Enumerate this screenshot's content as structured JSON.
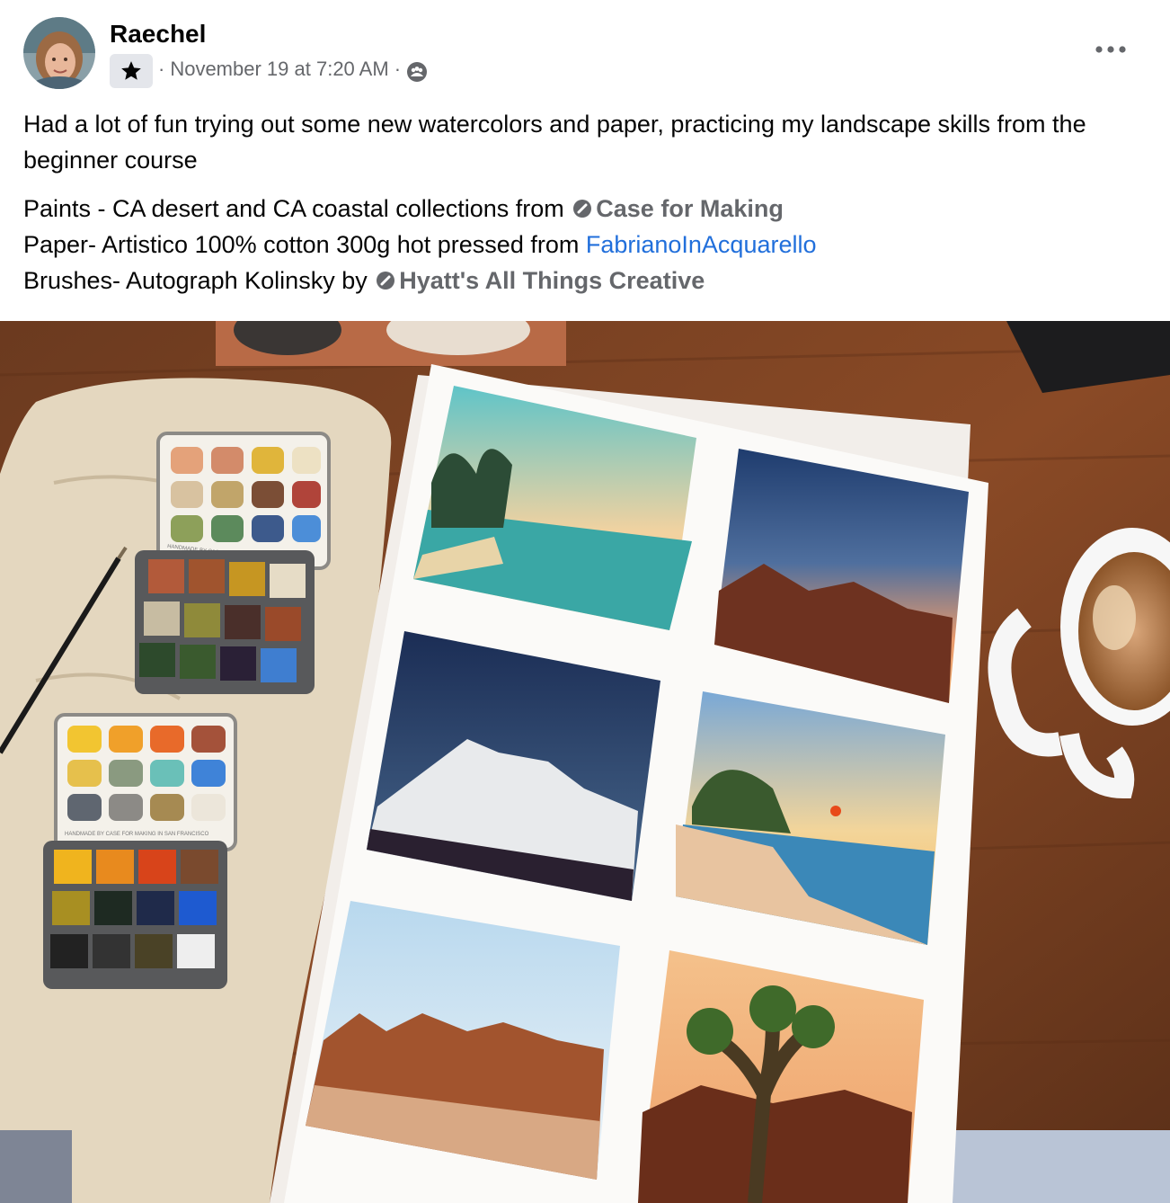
{
  "post": {
    "author": "Raechel",
    "badge_icon": "star-icon",
    "meta_separator": "·",
    "timestamp": "November 19 at 7:20 AM",
    "audience_icon": "group-audience-icon",
    "more_icon": "more-options-icon",
    "body_paragraph": "Had a lot of fun trying out some new watercolors and paper, practicing my landscape skills from the beginner course",
    "details": {
      "line1_prefix": "Paints - CA desert and CA coastal collections from ",
      "line1_link": "Case for Making",
      "line2_prefix": "Paper- Artistico 100% cotton 300g hot pressed from ",
      "line2_link": "FabrianoInAcquarello",
      "line3_prefix": "Brushes- Autograph Kolinsky by ",
      "line3_link": "Hyatt's All Things Creative"
    },
    "palette_label_1": "HANDMADE BY CASE FOR MAKING IN SAN FRANCISCO",
    "palette_label_2": "HANDMADE BY CASE FOR MAKING IN SAN FRANCISCO"
  },
  "colors": {
    "link_gray": "#65676b",
    "link_blue": "#216fdb",
    "badge_bg": "#e4e6eb",
    "text": "#050505"
  }
}
